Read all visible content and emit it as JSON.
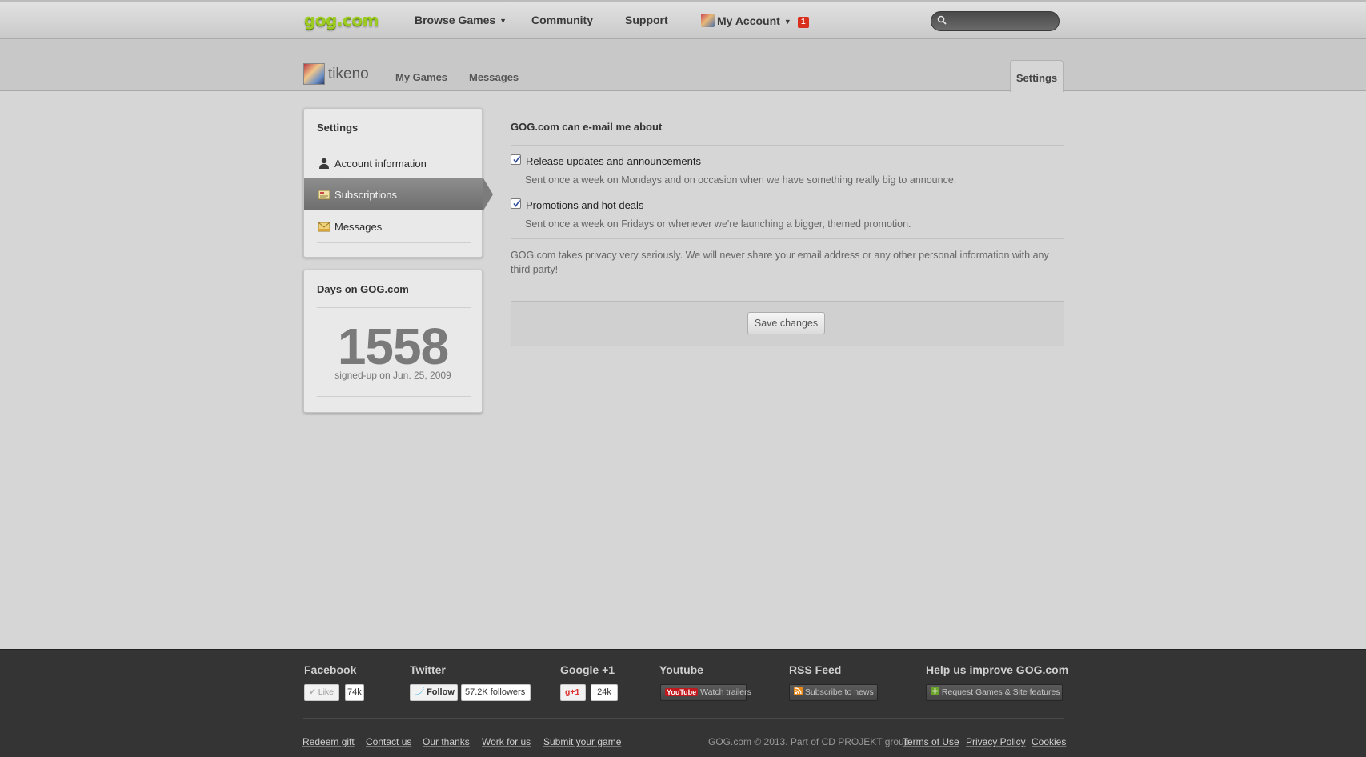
{
  "topnav": {
    "logo": "gog.com",
    "browse_games": "Browse Games",
    "community": "Community",
    "support": "Support",
    "my_account": "My Account",
    "notification_count": "1",
    "search_placeholder": ""
  },
  "profile": {
    "username": "tikeno",
    "tabs": [
      "My Games",
      "Messages"
    ],
    "settings_tab": "Settings"
  },
  "sidebar": {
    "title": "Settings",
    "items": [
      {
        "label": "Account information",
        "icon": "user-icon",
        "active": false
      },
      {
        "label": "Subscriptions",
        "icon": "subscriptions-icon",
        "active": true
      },
      {
        "label": "Messages",
        "icon": "mail-icon",
        "active": false
      }
    ]
  },
  "days": {
    "title": "Days on GOG.com",
    "count": "1558",
    "signed_up": "signed-up on Jun. 25, 2009"
  },
  "main": {
    "title": "GOG.com can e-mail me about",
    "options": [
      {
        "label": "Release updates and announcements",
        "checked": true,
        "description": "Sent once a week on Mondays and on occasion when we have something really big to announce."
      },
      {
        "label": "Promotions and hot deals",
        "checked": true,
        "description": "Sent once a week on Fridays or whenever we're launching a bigger, themed promotion."
      }
    ],
    "privacy": "GOG.com takes privacy very seriously. We will never share your email address or any other personal information with any third party!",
    "save_label": "Save changes"
  },
  "footer": {
    "facebook": {
      "title": "Facebook",
      "like": "Like",
      "count": "74k"
    },
    "twitter": {
      "title": "Twitter",
      "follow": "Follow",
      "followers": "57.2K followers"
    },
    "google": {
      "title": "Google +1",
      "plus": "+1",
      "count": "24k"
    },
    "youtube": {
      "title": "Youtube",
      "logo": "YouTube",
      "button": "Watch trailers"
    },
    "rss": {
      "title": "RSS Feed",
      "button": "Subscribe to news"
    },
    "improve": {
      "title": "Help us improve GOG.com",
      "button": "Request Games & Site features"
    },
    "links": [
      "Redeem gift",
      "Contact us",
      "Our thanks",
      "Work for us",
      "Submit your game"
    ],
    "copyright": "GOG.com © 2013. Part of CD PROJEKT group.",
    "legal_links": [
      "Terms of Use",
      "Privacy Policy",
      "Cookies"
    ]
  },
  "colors": {
    "logo_green": "#9ccc22",
    "badge_red": "#d8301c",
    "active_item": "#7c7c7c",
    "footer_bg": "#343434"
  }
}
